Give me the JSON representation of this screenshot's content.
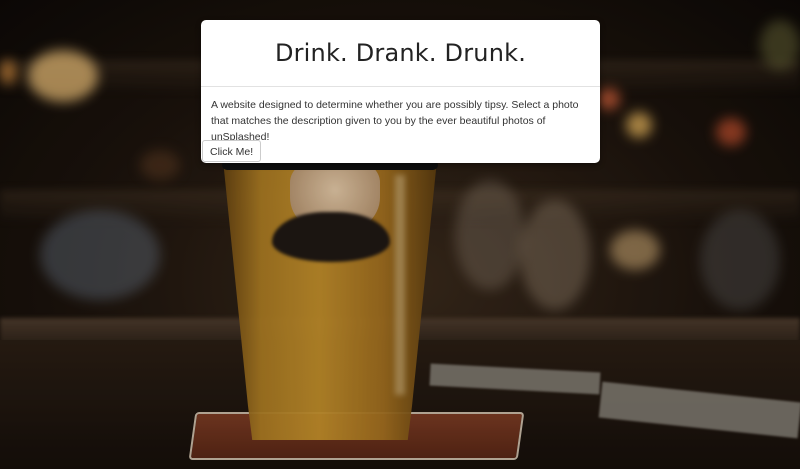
{
  "card": {
    "title": "Drink. Drank. Drunk.",
    "description": "A website designed to determine whether you are possibly tipsy. Select a photo that matches the description given to you by the ever beautiful photos of unSplashed!",
    "button_label": "Click Me!"
  },
  "background": {
    "subject": "beer glass with nose and mustache on bar counter",
    "accent_colors": [
      "#c8932c",
      "#1d140d",
      "#ffffff"
    ]
  }
}
